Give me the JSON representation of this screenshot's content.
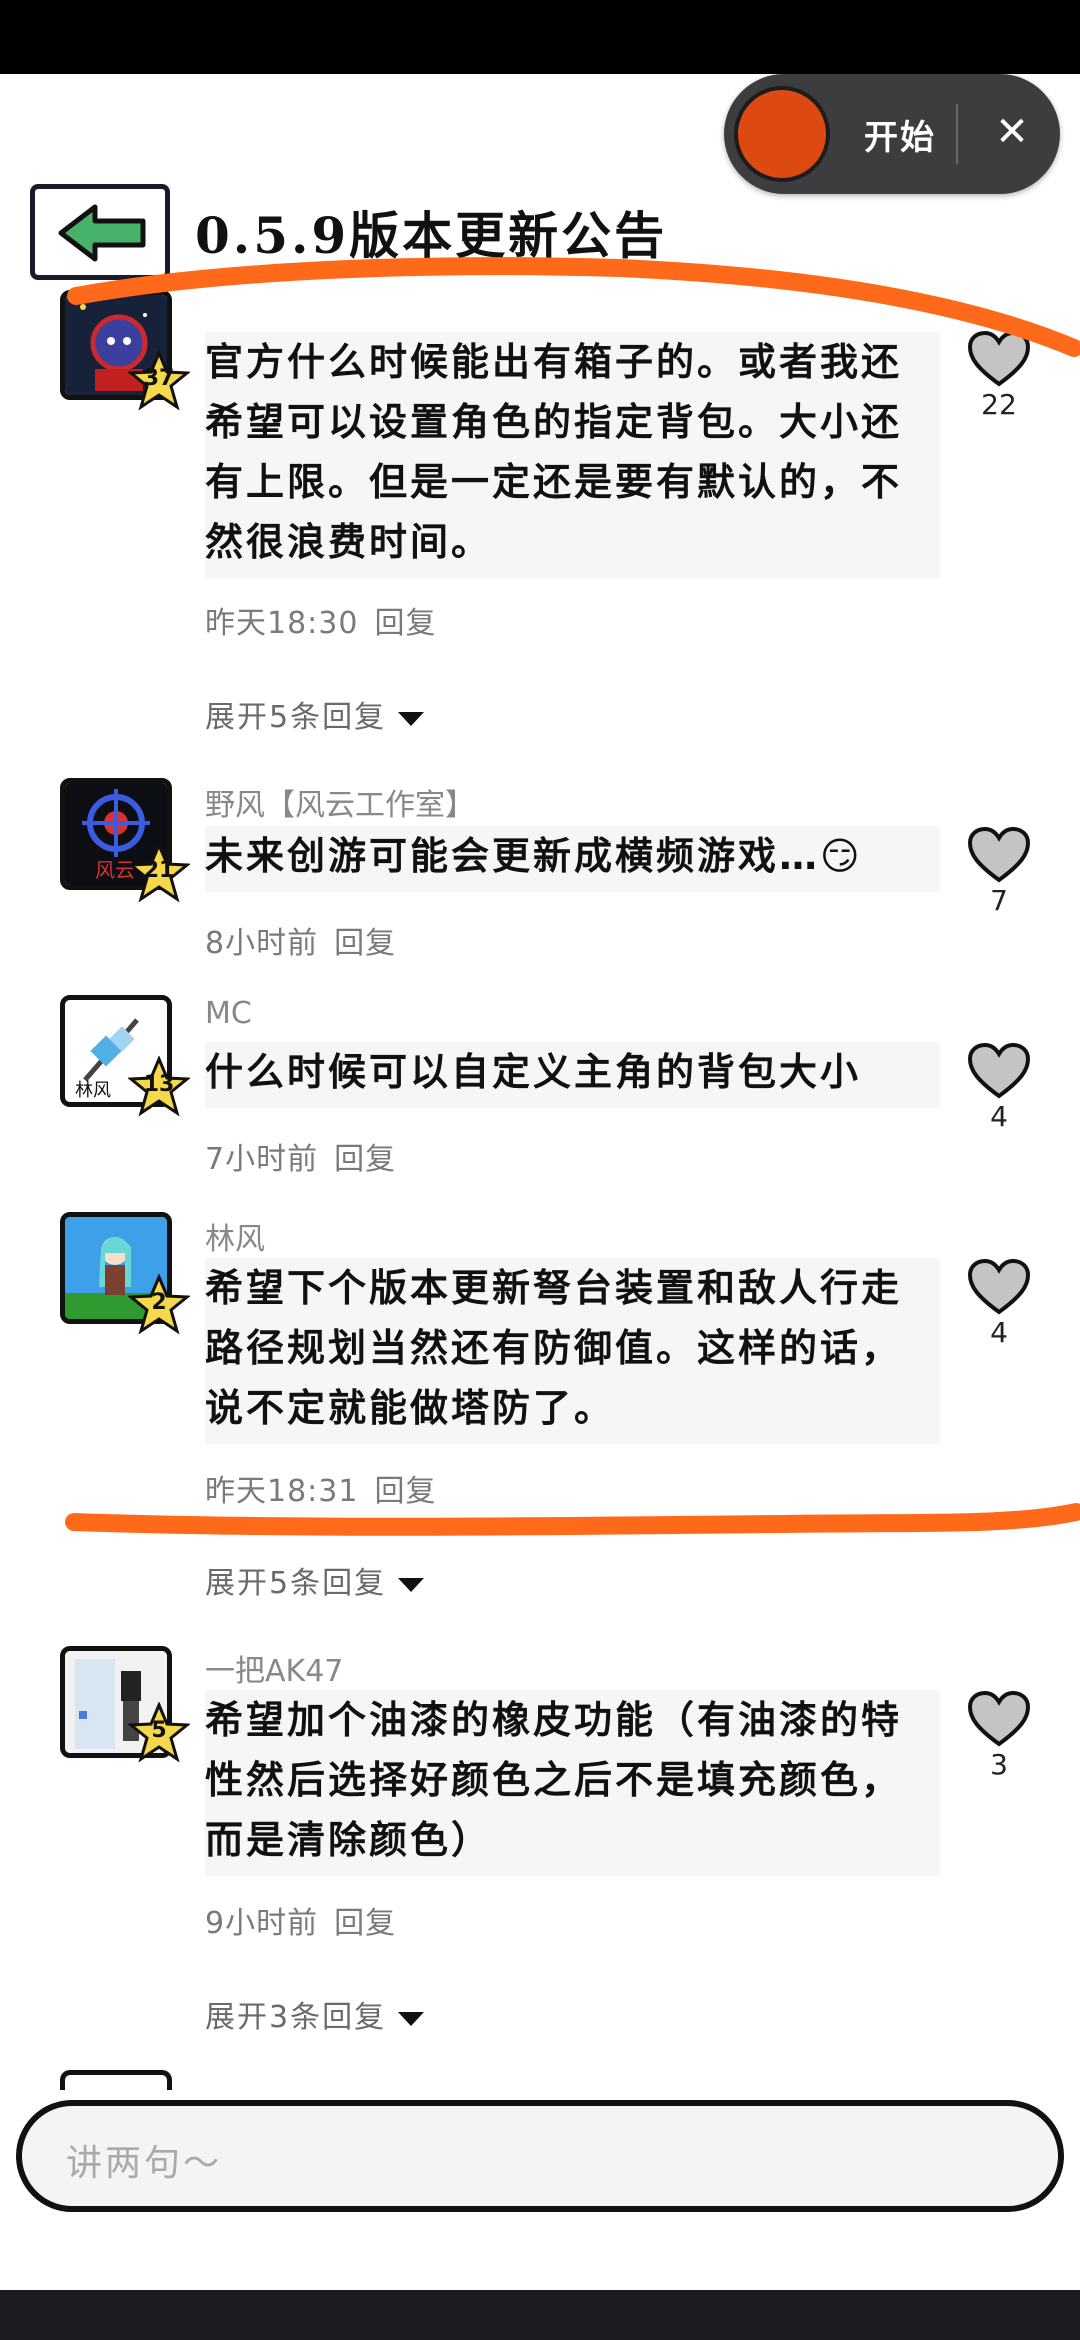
{
  "recorder": {
    "start_label": "开始",
    "close_icon": "close-icon",
    "color": "#dc4a12"
  },
  "header": {
    "title": "0.5.9版本更新公告",
    "back_icon": "back-arrow-icon",
    "back_color": "#47b36a"
  },
  "comments": [
    {
      "content": "官方什么时候能出有箱子的。或者我还希望可以设置角色的指定背包。大小还有上限。但是一定还是要有默认的，不然很浪费时间。",
      "time": "昨天18:30",
      "reply": "回复",
      "likes": "22",
      "level": "37",
      "expand": "展开5条回复"
    },
    {
      "username": "野风【风云工作室】",
      "content": "未来创游可能会更新成横频游戏…😏",
      "time": "8小时前",
      "reply": "回复",
      "likes": "7",
      "level": "21"
    },
    {
      "username": "MC",
      "content": "什么时候可以自定义主角的背包大小",
      "time": "7小时前",
      "reply": "回复",
      "likes": "4",
      "level": "13"
    },
    {
      "username": "林风",
      "content": "希望下个版本更新弩台装置和敌人行走路径规划当然还有防御值。这样的话，说不定就能做塔防了。",
      "time": "昨天18:31",
      "reply": "回复",
      "likes": "4",
      "level": "2",
      "expand": "展开5条回复"
    },
    {
      "username": "一把AK47",
      "content": "希望加个油漆的橡皮功能（有油漆的特性然后选择好颜色之后不是填充颜色，而是清除颜色）",
      "time": "9小时前",
      "reply": "回复",
      "likes": "3",
      "level": "5",
      "expand": "展开3条回复"
    }
  ],
  "input": {
    "placeholder": "讲两句～"
  },
  "annotation_color": "#ff6a1a"
}
